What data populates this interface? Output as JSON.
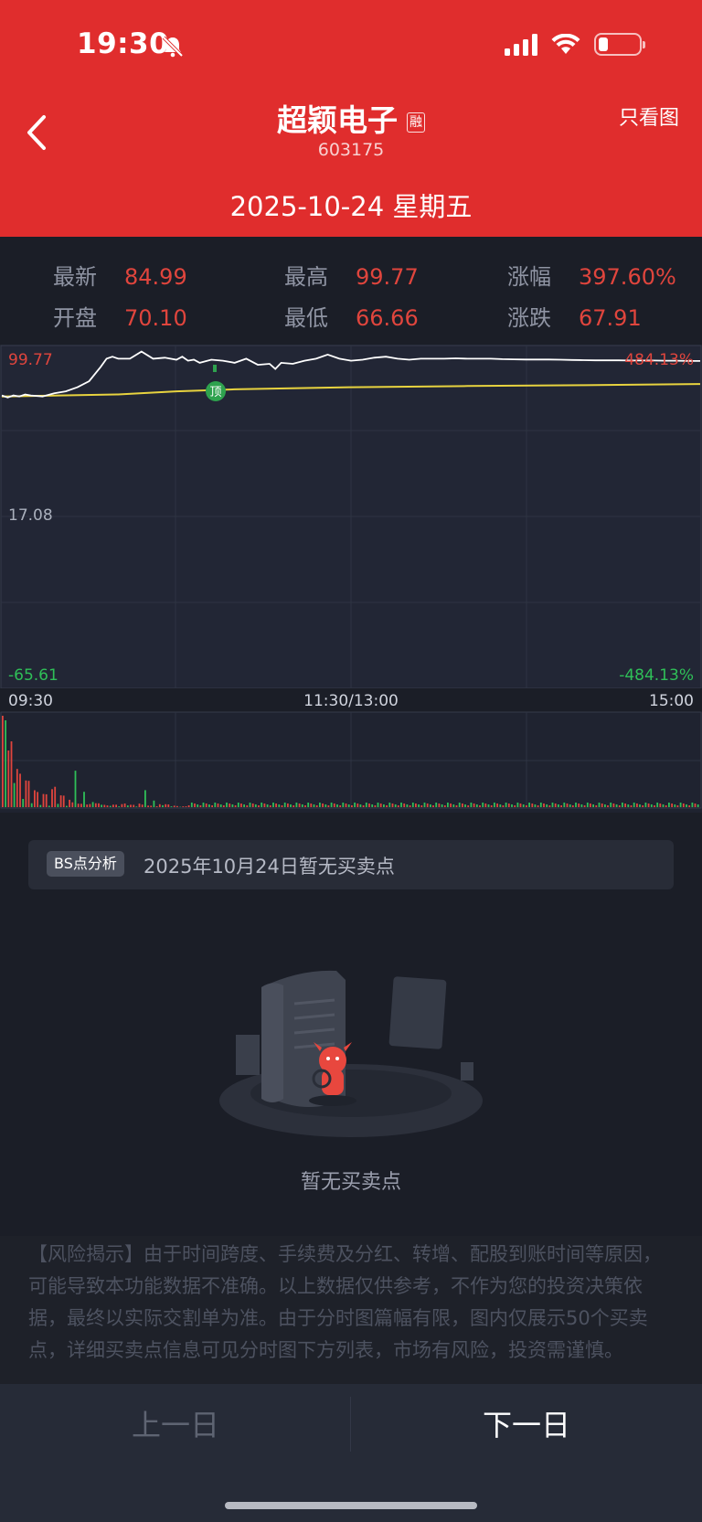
{
  "status_bar": {
    "time": "19:30"
  },
  "header": {
    "title": "超颖电子",
    "badge": "融",
    "code": "603175",
    "right_action": "只看图",
    "date": "2025-10-24  星期五"
  },
  "stats": {
    "latest_label": "最新",
    "latest_value": "84.99",
    "high_label": "最高",
    "high_value": "99.77",
    "change_pct_label": "涨幅",
    "change_pct_value": "397.60%",
    "open_label": "开盘",
    "open_value": "70.10",
    "low_label": "最低",
    "low_value": "66.66",
    "change_label": "涨跌",
    "change_value": "67.91"
  },
  "chart_data": {
    "type": "line",
    "y_labels_left": [
      "99.77",
      "17.08",
      "-65.61"
    ],
    "y_labels_right": [
      "484.13%",
      "-484.13%"
    ],
    "x_labels": [
      "09:30",
      "11:30/13:00",
      "15:00"
    ],
    "ylim": [
      -65.61,
      99.77
    ],
    "annotation": "顶",
    "series": [
      {
        "color": "#ffffff",
        "x": [
          0,
          2,
          4,
          6,
          8,
          10,
          14,
          18,
          22,
          26,
          30,
          34,
          36,
          38,
          40,
          44,
          48,
          52,
          56,
          60,
          62,
          64,
          66,
          68,
          72,
          76,
          80,
          84,
          88,
          92,
          94,
          96,
          100,
          104,
          108,
          112,
          116,
          120,
          124,
          128,
          132,
          136,
          140,
          144,
          148,
          152,
          156,
          160,
          164,
          168,
          172,
          176,
          180,
          184,
          188,
          192,
          196,
          200,
          204,
          208,
          212,
          216,
          220,
          224,
          228,
          232,
          236,
          240
        ],
        "values": [
          78,
          77,
          78,
          77.5,
          78.5,
          78,
          77.5,
          79,
          80,
          82,
          85,
          92,
          96,
          97,
          96,
          96,
          99.5,
          96,
          96.5,
          95.5,
          97,
          95,
          95.5,
          94,
          95.5,
          95,
          94,
          96,
          93,
          93.5,
          91,
          94,
          93.5,
          95,
          96,
          98,
          96,
          95,
          95.5,
          96.5,
          97,
          96,
          95.5,
          96,
          96,
          96,
          96.2,
          96,
          96,
          96,
          95.8,
          95.7,
          95.6,
          95.6,
          95.6,
          95.5,
          95.4,
          95.3,
          95.2,
          95.2,
          95.2,
          95.1,
          95.1,
          95.1,
          95.0,
          95.0,
          94.9,
          94.9
        ]
      },
      {
        "color": "#e8d33f",
        "x": [
          0,
          40,
          60,
          80,
          120,
          160,
          200,
          240
        ],
        "values": [
          77.5,
          78.5,
          80,
          81,
          82,
          82.6,
          83,
          83.6
        ]
      }
    ],
    "volume": {
      "red": [
        95,
        72,
        45,
        40,
        33,
        22,
        20,
        18,
        26,
        30,
        18,
        12,
        8,
        6,
        5,
        6,
        8,
        5,
        4,
        6,
        8,
        10,
        7,
        12,
        9,
        6,
        4,
        14,
        16,
        10,
        8,
        6,
        5,
        4
      ],
      "green": [
        100,
        62,
        50,
        34,
        28,
        18,
        14,
        10,
        6,
        4,
        5,
        4,
        3,
        3,
        4,
        3,
        2,
        3,
        4,
        5,
        2,
        3,
        2,
        3
      ]
    }
  },
  "bs_box": {
    "tag": "BS点分析",
    "text": "2025年10月24日暂无买卖点"
  },
  "empty_text": "暂无买卖点",
  "risk_text": "【风险揭示】由于时间跨度、手续费及分红、转增、配股到账时间等原因，可能导致本功能数据不准确。以上数据仅供参考，不作为您的投资决策依据，最终以实际交割单为准。由于分时图篇幅有限，图内仅展示50个买卖点，详细买卖点信息可见分时图下方列表，市场有风险，投资需谨慎。",
  "bottom": {
    "prev": "上一日",
    "next": "下一日"
  }
}
